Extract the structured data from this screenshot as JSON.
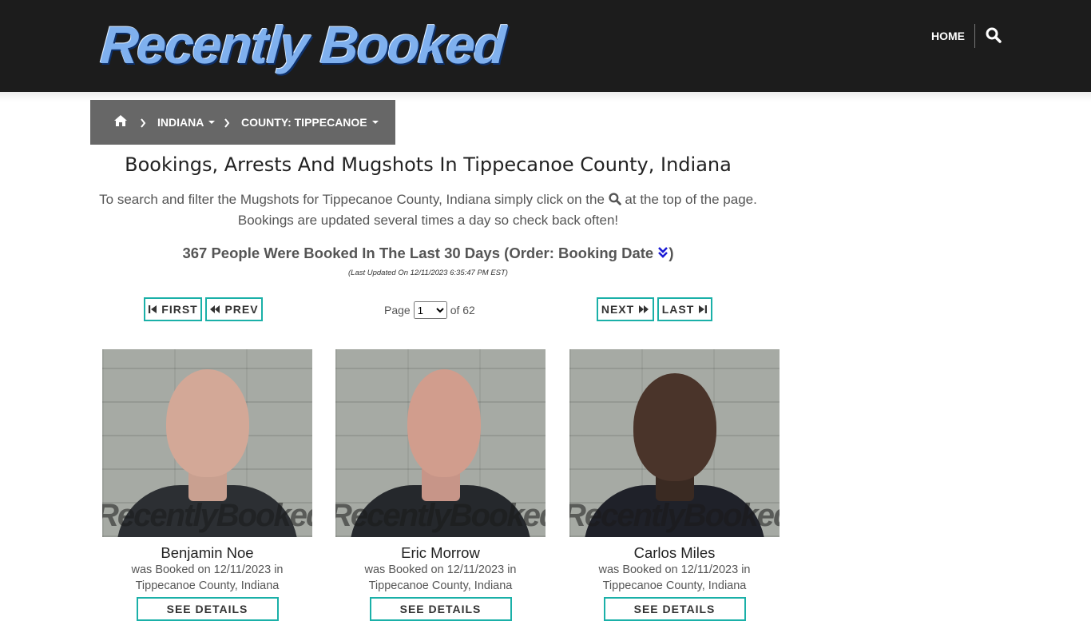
{
  "header": {
    "logo_text": "Recently Booked",
    "nav_home": "HOME",
    "search_icon": "search-icon"
  },
  "breadcrumb": {
    "home_icon": "home-icon",
    "items": [
      {
        "label": "INDIANA"
      },
      {
        "label": "COUNTY: TIPPECANOE"
      }
    ]
  },
  "main": {
    "title": "Bookings, Arrests And Mugshots In Tippecanoe County, Indiana",
    "intro_part1": "To search and filter the Mugshots for Tippecanoe County, Indiana simply click on the",
    "intro_part2": "at the top of the page.",
    "intro_line2": "Bookings are updated several times a day so check back often!",
    "count_text": "367 People Were Booked In The Last 30 Days (Order: Booking Date",
    "count_close": ")",
    "last_updated": "(Last Updated On 12/11/2023 6:35:47 PM EST)"
  },
  "pager": {
    "first": "FIRST",
    "prev": "PREV",
    "next": "NEXT",
    "last": "LAST",
    "page_label": "Page",
    "page_value": "1",
    "of_label": "of 62"
  },
  "cards": [
    {
      "name": "Benjamin Noe",
      "booked_line1": "was Booked on 12/11/2023 in",
      "booked_line2": "Tippecanoe County, Indiana",
      "details_label": "SEE DETAILS",
      "watermark": "RecentlyBooked.com"
    },
    {
      "name": "Eric Morrow",
      "booked_line1": "was Booked on 12/11/2023 in",
      "booked_line2": "Tippecanoe County, Indiana",
      "details_label": "SEE DETAILS",
      "watermark": "RecentlyBooked.com"
    },
    {
      "name": "Carlos Miles",
      "booked_line1": "was Booked on 12/11/2023 in",
      "booked_line2": "Tippecanoe County, Indiana",
      "details_label": "SEE DETAILS",
      "watermark": "RecentlyBooked.com"
    }
  ],
  "colors": {
    "header_bg": "#1c1c1c",
    "breadcrumb_bg": "#676767",
    "button_border": "#1ab0a8",
    "sort_icon": "#1b1bd6"
  }
}
